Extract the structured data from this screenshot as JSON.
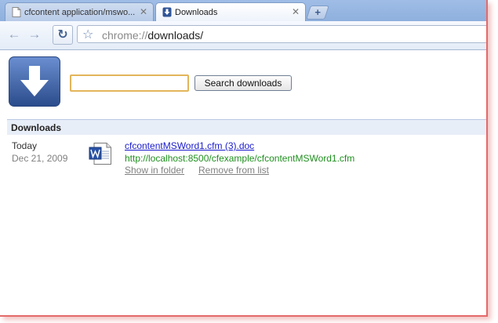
{
  "tabs": [
    {
      "title": "cfcontent application/mswo...",
      "active": false
    },
    {
      "title": "Downloads",
      "active": true
    }
  ],
  "new_tab_label": "+",
  "toolbar": {
    "url_scheme": "chrome://",
    "url_path": "downloads/"
  },
  "search": {
    "value": "",
    "button_label": "Search downloads"
  },
  "section_title": "Downloads",
  "downloads": [
    {
      "date_label": "Today",
      "date": "Dec 21, 2009",
      "file_name": "cfcontentMSWord1.cfm (3).doc",
      "source_url": "http://localhost:8500/cfexample/cfcontentMSWord1.cfm",
      "show_in_folder": "Show in folder",
      "remove_from_list": "Remove from list"
    }
  ],
  "colors": {
    "link": "#1a1acc",
    "source_url": "#1f8f1f",
    "muted": "#808080",
    "accent": "#2d4f91"
  }
}
